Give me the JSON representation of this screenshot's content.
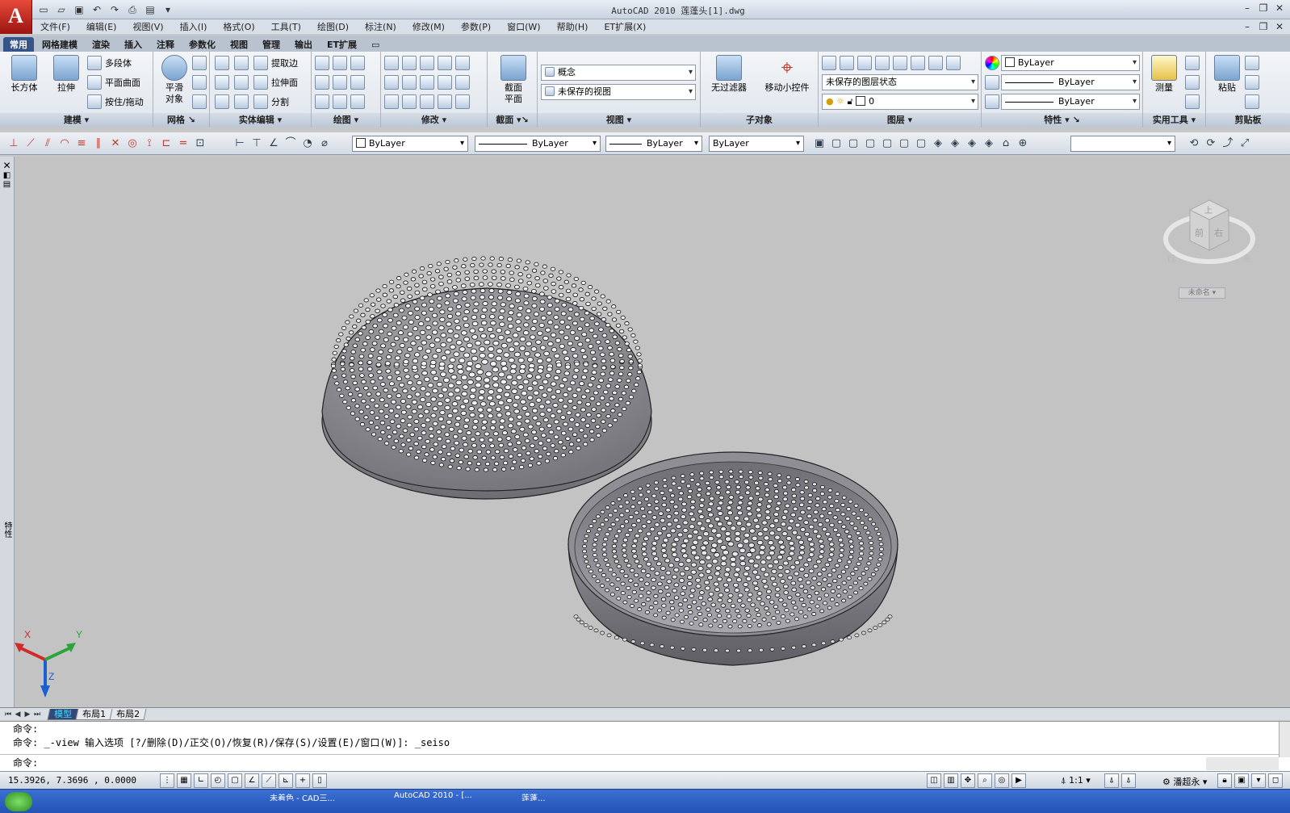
{
  "title_bar": {
    "window_title": "AutoCAD 2010    莲蓬头[1].dwg"
  },
  "menu": [
    "文件(F)",
    "编辑(E)",
    "视图(V)",
    "插入(I)",
    "格式(O)",
    "工具(T)",
    "绘图(D)",
    "标注(N)",
    "修改(M)",
    "参数(P)",
    "窗口(W)",
    "帮助(H)",
    "ET扩展(X)"
  ],
  "ribbon_tabs": [
    "常用",
    "网格建模",
    "渲染",
    "插入",
    "注释",
    "参数化",
    "视图",
    "管理",
    "输出",
    "ET扩展"
  ],
  "ribbon": {
    "modeling": {
      "title": "建模",
      "box": "长方体",
      "extrude": "拉伸",
      "polysolid": "多段体",
      "planesurf": "平面曲面",
      "presspull": "按住/拖动"
    },
    "mesh": {
      "title": "网格",
      "smooth": "平滑\n对象"
    },
    "solidedit": {
      "title": "实体编辑",
      "extract": "提取边",
      "extrude_faces": "拉伸面",
      "separate": "分割"
    },
    "draw": {
      "title": "绘图"
    },
    "modify": {
      "title": "修改"
    },
    "section": {
      "title": "截面",
      "plane": "截面\n平面"
    },
    "view": {
      "title": "视图",
      "visual_style": "概念",
      "saved_view": "未保存的视图"
    },
    "subobject": {
      "title": "子对象",
      "no_filter": "无过滤器",
      "gizmo": "移动小控件"
    },
    "layers": {
      "title": "图层",
      "layer_state": "未保存的图层状态",
      "current_layer": "0"
    },
    "properties": {
      "title": "特性",
      "color": "ByLayer",
      "linetype": "ByLayer",
      "lineweight": "ByLayer"
    },
    "utilities": {
      "title": "实用工具",
      "measure": "测量"
    },
    "clipboard": {
      "title": "剪贴板",
      "paste": "粘贴"
    }
  },
  "toolbar2": {
    "color": "ByLayer",
    "linetype": "ByLayer",
    "lineweight": "ByLayer",
    "plotstyle": "ByLayer"
  },
  "viewport": {
    "viewcube_top": "上",
    "viewcube_front": "前",
    "viewcube_right": "右",
    "viewcube_south": "南",
    "viewcube_east": "东",
    "viewcube_west": "西",
    "ucs_name": "未命名",
    "axis_x": "X",
    "axis_y": "Y",
    "axis_z": "Z",
    "palette_label": "特性"
  },
  "layout_tabs": [
    "模型",
    "布局1",
    "布局2"
  ],
  "command": {
    "line1": "命令:",
    "line2": "命令: _-view 输入选项 [?/删除(D)/正交(O)/恢复(R)/保存(S)/设置(E)/窗口(W)]: _seiso",
    "line3": "命令:"
  },
  "status": {
    "coords": "15.3926, 7.3696 , 0.0000",
    "scale": "1:1",
    "user": "潘超永"
  },
  "taskbar": {
    "items": [
      "未着色 - CAD三...",
      "AutoCAD 2010 - [...",
      "莲蓬..."
    ]
  }
}
